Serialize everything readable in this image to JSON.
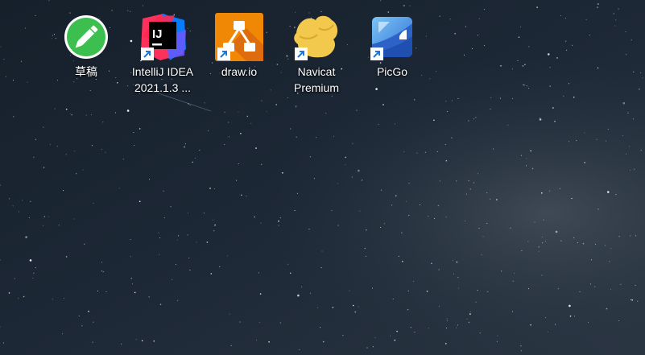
{
  "desktop": {
    "icons": [
      {
        "label": "草稿",
        "icon": "pencil-icon",
        "shortcut": false
      },
      {
        "label": "IntelliJ IDEA\n2021.1.3 ...",
        "icon": "intellij-idea-icon",
        "shortcut": true
      },
      {
        "label": "draw.io",
        "icon": "drawio-icon",
        "shortcut": true
      },
      {
        "label": "Navicat\nPremium",
        "icon": "navicat-icon",
        "shortcut": true
      },
      {
        "label": "PicGo",
        "icon": "picgo-icon",
        "shortcut": true
      }
    ]
  },
  "colors": {
    "background": "#1b2532",
    "drafts_green": "#3cbf4f",
    "drawio_orange": "#f08705",
    "navicat_yellow": "#f2c94c",
    "picgo_blue": "#3b82e0",
    "shortcut_arrow_blue": "#1e78d6"
  }
}
